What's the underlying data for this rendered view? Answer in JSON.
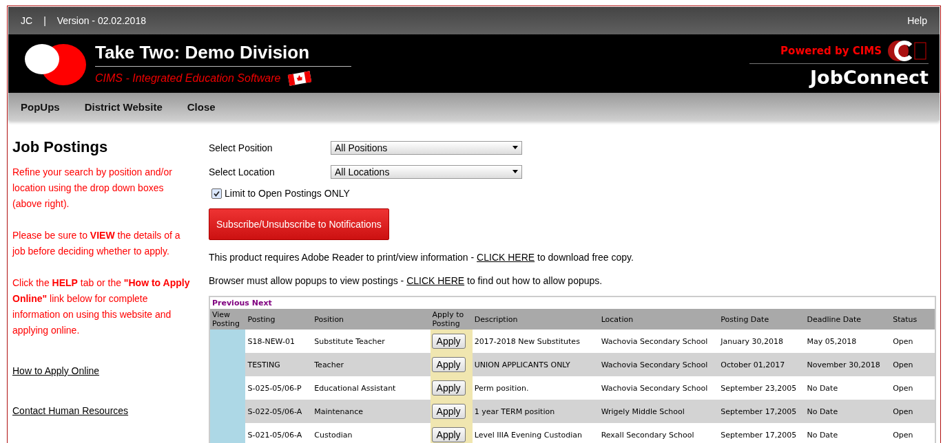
{
  "top_bar": {
    "user": "JC",
    "separator": "|",
    "version": "Version - 02.02.2018",
    "help": "Help"
  },
  "header": {
    "title": "Take Two: Demo Division",
    "subtitle": "CIMS - Integrated Education Software",
    "powered_by": "Powered by CIMS",
    "product": "JobConnect"
  },
  "nav": [
    "PopUps",
    "District Website",
    "Close"
  ],
  "sidebar": {
    "title": "Job Postings",
    "paragraphs": [
      "Refine your search by position and/or location using the drop down boxes (above right).",
      "Please be sure to **VIEW** the details of a job before deciding whether to apply.",
      "Click the **HELP** tab or the **\"How to Apply Online\"** link below for complete information on using this website and applying online."
    ],
    "links": [
      "How to Apply Online",
      "Contact Human Resources"
    ]
  },
  "filters": [
    {
      "label": "Select Position",
      "value": "All Positions"
    },
    {
      "label": "Select Location",
      "value": "All Locations"
    }
  ],
  "open_only": {
    "label": "Limit to Open Postings ONLY",
    "checked": true
  },
  "subscribe_button": "Subscribe/Unsubscribe to Notifications",
  "notes": [
    {
      "before": "This product requires Adobe Reader to print/view information - ",
      "link": "CLICK HERE",
      "after": " to download free copy."
    },
    {
      "before": "Browser must allow popups to view postings - ",
      "link": "CLICK HERE",
      "after": " to find out how to allow popups."
    }
  ],
  "pager": [
    "Previous",
    "Next"
  ],
  "table": {
    "columns": [
      "View Posting",
      "Posting",
      "Position",
      "Apply to Posting",
      "Description",
      "Location",
      "Posting Date",
      "Deadline Date",
      "Status"
    ],
    "rows": [
      {
        "posting": "S18-NEW-01",
        "position": "Substitute Teacher",
        "apply": "Apply",
        "description": "2017-2018 New Substitutes",
        "location": "Wachovia Secondary School",
        "posting_date": "January 30,2018",
        "deadline": "May 05,2018",
        "status": "Open"
      },
      {
        "posting": "TESTING",
        "position": "Teacher",
        "apply": "Apply",
        "description": "UNION APPLICANTS ONLY",
        "location": "Wachovia Secondary School",
        "posting_date": "October 01,2017",
        "deadline": "November 30,2018",
        "status": "Open"
      },
      {
        "posting": "S-025-05/06-P",
        "position": "Educational Assistant",
        "apply": "Apply",
        "description": "Perm position.",
        "location": "Wachovia Secondary School",
        "posting_date": "September 23,2005",
        "deadline": "No Date",
        "status": "Open"
      },
      {
        "posting": "S-022-05/06-A",
        "position": "Maintenance",
        "apply": "Apply",
        "description": "1 year TERM position",
        "location": "Wrigely Middle School",
        "posting_date": "September 17,2005",
        "deadline": "No Date",
        "status": "Open"
      },
      {
        "posting": "S-021-05/06-A",
        "position": "Custodian",
        "apply": "Apply",
        "description": "Level IIIA Evening Custodian",
        "location": "Rexall Secondary School",
        "posting_date": "September 17,2005",
        "deadline": "No Date",
        "status": "Open"
      }
    ]
  }
}
